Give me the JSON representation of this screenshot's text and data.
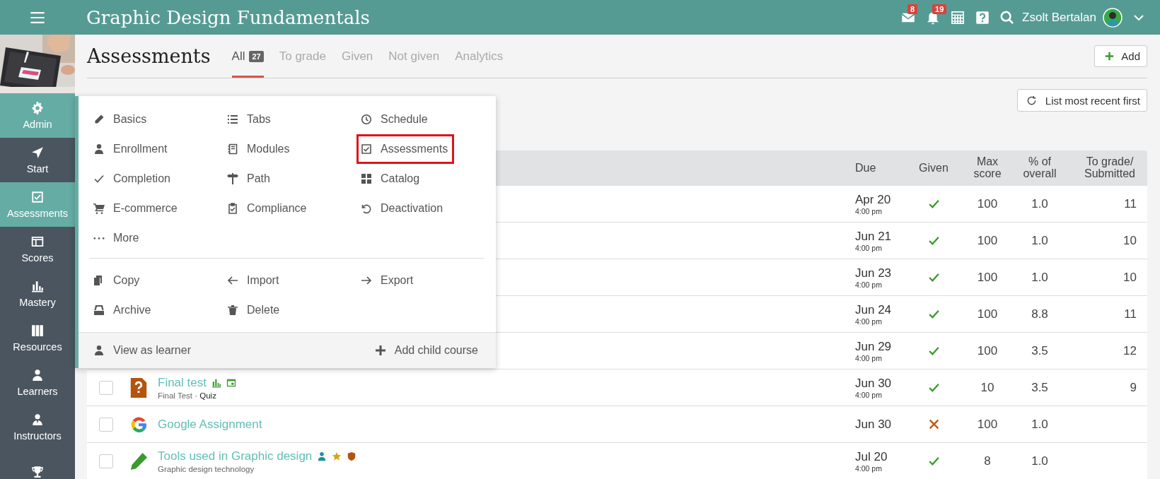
{
  "topbar": {
    "course_title": "Graphic Design Fundamentals",
    "notifications": [
      {
        "count": "8"
      },
      {
        "count": "19"
      }
    ],
    "user": {
      "name": "Zsolt Bertalan"
    }
  },
  "sidebar": {
    "items": [
      {
        "label": "Admin",
        "selected": true
      },
      {
        "label": "Start",
        "selected": false
      },
      {
        "label": "Assessments",
        "selected": true
      },
      {
        "label": "Scores",
        "selected": false
      },
      {
        "label": "Mastery",
        "selected": false
      },
      {
        "label": "Resources",
        "selected": false
      },
      {
        "label": "Learners",
        "selected": false
      },
      {
        "label": "Instructors",
        "selected": false
      },
      {
        "selected": false
      }
    ]
  },
  "page": {
    "title": "Assessments",
    "tabs": [
      {
        "label": "All",
        "count": "27",
        "selected": true
      },
      {
        "label": "To grade",
        "selected": false
      },
      {
        "label": "Given",
        "selected": false
      },
      {
        "label": "Not given",
        "selected": false
      },
      {
        "label": "Analytics",
        "selected": false
      }
    ],
    "add_button": "Add",
    "sort_button": "List most recent first"
  },
  "table": {
    "columns": [
      "Due",
      "Given",
      "Max score",
      "% of overall",
      "To grade/ Submitted"
    ],
    "rows": [
      {
        "due": "Apr 20",
        "time": "4:00 pm",
        "given": true,
        "max_score": "100",
        "percent": "1.0",
        "to_grade": "11"
      },
      {
        "due": "Jun 21",
        "time": "4:00 pm",
        "given": true,
        "max_score": "100",
        "percent": "1.0",
        "to_grade": "10"
      },
      {
        "due": "Jun 23",
        "time": "4:00 pm",
        "given": true,
        "max_score": "100",
        "percent": "1.0",
        "to_grade": "10"
      },
      {
        "due": "Jun 24",
        "time": "4:00 pm",
        "given": true,
        "max_score": "100",
        "percent": "8.8",
        "to_grade": "11"
      },
      {
        "due": "Jun 29",
        "time": "4:00 pm",
        "given": true,
        "max_score": "100",
        "percent": "3.5",
        "to_grade": "12"
      },
      {
        "kind": "quiz",
        "checked": false,
        "title": "Final test",
        "subtitle": "Final Test · ",
        "type": "Quiz",
        "due": "Jun 30",
        "time": "4:00 pm",
        "given": true,
        "max_score": "10",
        "percent": "3.5",
        "to_grade": "9"
      },
      {
        "kind": "google",
        "checked": false,
        "title": "Google Assignment",
        "due": "Jun 30",
        "given": false,
        "max_score": "100",
        "percent": "1.0"
      },
      {
        "kind": "pencil",
        "checked": false,
        "title": "Tools used in Graphic design",
        "subtitle": "Graphic design technology",
        "due": "Jul 20",
        "time": "4:00 pm",
        "given": true,
        "max_score": "8",
        "percent": "1.0"
      }
    ]
  },
  "admin_menu": {
    "items": [
      {
        "label": "Basics",
        "outlined": false
      },
      {
        "label": "Tabs",
        "outlined": false
      },
      {
        "label": "Schedule",
        "outlined": false
      },
      {
        "label": "Enrollment",
        "outlined": false
      },
      {
        "label": "Modules",
        "outlined": false
      },
      {
        "label": "Assessments",
        "outlined": true
      },
      {
        "label": "Completion",
        "outlined": false
      },
      {
        "label": "Path",
        "outlined": false
      },
      {
        "label": "Catalog",
        "outlined": false
      },
      {
        "label": "E-commerce",
        "outlined": false
      },
      {
        "label": "Compliance",
        "outlined": false
      },
      {
        "label": "Deactivation",
        "outlined": false
      },
      {
        "label": "More",
        "outlined": false
      }
    ],
    "actions": [
      {
        "label": "Copy"
      },
      {
        "label": "Import"
      },
      {
        "label": "Export"
      },
      {
        "label": "Archive"
      },
      {
        "label": "Delete"
      }
    ],
    "footer": [
      {
        "label": "View as learner"
      },
      {
        "label": "Add child course"
      }
    ]
  }
}
